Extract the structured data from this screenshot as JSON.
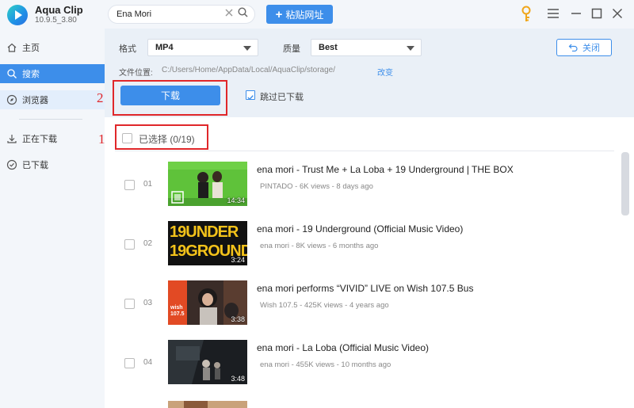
{
  "app": {
    "name": "Aqua Clip",
    "version": "10.9.5_3.80"
  },
  "search": {
    "value": "Ena Mori"
  },
  "paste_button": {
    "plus": "+",
    "label": "粘贴网址"
  },
  "sidebar": {
    "items": [
      {
        "label": "主页",
        "icon": "home-icon"
      },
      {
        "label": "搜索",
        "icon": "search-icon"
      },
      {
        "label": "浏览器",
        "icon": "compass-icon"
      },
      {
        "label": "正在下载",
        "icon": "download-icon"
      },
      {
        "label": "已下载",
        "icon": "check-circle-icon"
      }
    ]
  },
  "options": {
    "format_label": "格式",
    "format_value": "MP4",
    "quality_label": "质量",
    "quality_value": "Best",
    "close_label": "关闭",
    "path_label": "文件位置:",
    "path_value": "C:/Users/Home/AppData/Local/AquaClip/storage/",
    "change_label": "改变",
    "download_label": "下载",
    "skip_label": "跳过已下载",
    "skip_checked": true
  },
  "annotations": {
    "one": "1",
    "two": "2"
  },
  "list": {
    "select_all_label": "已选择 (0/19)",
    "items": [
      {
        "index": "01",
        "title": "ena mori - Trust Me + La Loba + 19 Underground | THE BOX",
        "meta": "PINTADO - 6K views - 8 days ago",
        "duration": "14:34"
      },
      {
        "index": "02",
        "title": "ena mori - 19 Underground (Official Music Video)",
        "meta": "ena mori - 8K views - 6 months ago",
        "duration": "3:24"
      },
      {
        "index": "03",
        "title": "ena mori performs “VIVID” LIVE on Wish 107.5 Bus",
        "meta": "Wish 107.5 - 425K views - 4 years ago",
        "duration": "3:38"
      },
      {
        "index": "04",
        "title": "ena mori - La Loba (Official Music Video)",
        "meta": "ena mori - 455K views - 10 months ago",
        "duration": "3:48"
      }
    ],
    "thumb_texts": {
      "underground": "19UNDER 19GROUND",
      "wish": "wish 107.5"
    }
  },
  "colors": {
    "accent": "#3d8eea",
    "annotation": "#e0272a",
    "sidebar_bg": "#f3f6fa",
    "options_bg": "#eaf0f7"
  }
}
